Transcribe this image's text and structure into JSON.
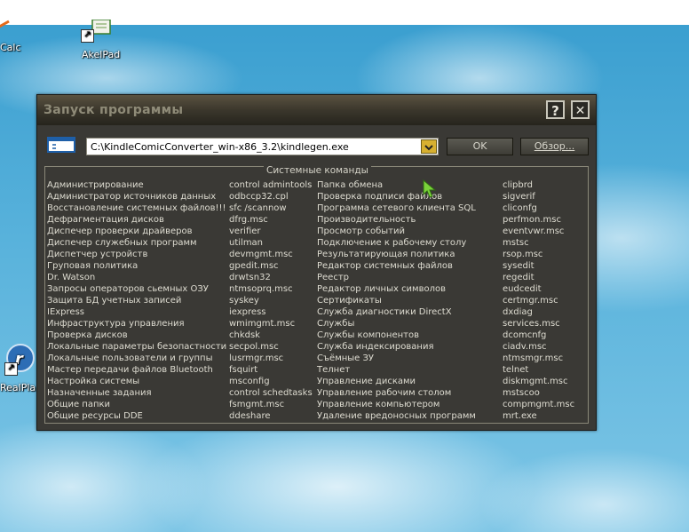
{
  "desktop": {
    "icons": [
      {
        "name": "Calc",
        "label": "Calc"
      },
      {
        "name": "AkelPad",
        "label": "AkelPad"
      },
      {
        "name": "RealPlayer",
        "label": "RealPla"
      }
    ]
  },
  "dialog": {
    "title": "Запуск программы",
    "help_label": "?",
    "close_label": "✕",
    "command_value": "C:\\KindleComicConverter_win-x86_3.2\\kindlegen.exe",
    "ok_label": "OK",
    "browse_label": "Обзор...",
    "group_title": "Системные команды",
    "columns": [
      {
        "items": [
          "Администрирование",
          "Администратор источников данных",
          "Восстановление системных файлов!!!",
          "Дефрагментация дисков",
          "Диспечер проверки драйверов",
          "Диспечер служебных программ",
          "Диспетчер устройств",
          "Груповая политика",
          "Dr. Watson",
          "Запросы операторов сьемных ОЗУ",
          "Защита БД учетных записей",
          "IExpress",
          "Инфраструктура управления",
          "Проверка дисков",
          "Локальные параметры безопастности",
          "Локальные пользователи и группы",
          "Мастер передачи файлов Bluetooth",
          "Настройка системы",
          "Назначенные задания",
          "Общие папки",
          "Общие ресурсы DDE"
        ]
      },
      {
        "items": [
          "control admintools",
          "odbccp32.cpl",
          "sfc /scannow",
          "dfrg.msc",
          "verifier",
          "utilman",
          "devmgmt.msc",
          "gpedit.msc",
          "drwtsn32",
          "ntmsoprq.msc",
          "syskey",
          "iexpress",
          "wmimgmt.msc",
          "chkdsk",
          "secpol.msc",
          "lusrmgr.msc",
          "fsquirt",
          "msconfig",
          "control schedtasks",
          "fsmgmt.msc",
          "ddeshare"
        ]
      },
      {
        "items": [
          "Папка обмена",
          "Проверка подписи файлов",
          "Программа сетевого клиента SQL",
          "Производительность",
          "Просмотр событий",
          "Подключение к рабочему столу",
          "Результатирующая политика",
          "Редактор системных файлов",
          "Реестр",
          "Редактор личных символов",
          "Сертификаты",
          "Служба диагностики DirectX",
          "Службы",
          "Службы компонентов",
          "Служба индексирования",
          "Съёмные ЗУ",
          "Телнет",
          "Управление дисками",
          "Управление рабочим столом",
          "Управление компьютером",
          "Удаление вредоносных программ"
        ]
      },
      {
        "items": [
          "clipbrd",
          "sigverif",
          "cliconfg",
          "perfmon.msc",
          "eventvwr.msc",
          "mstsc",
          "rsop.msc",
          "sysedit",
          "regedit",
          "eudcedit",
          "certmgr.msc",
          "dxdiag",
          "services.msc",
          "dcomcnfg",
          "ciadv.msc",
          "ntmsmgr.msc",
          "telnet",
          "diskmgmt.msc",
          "mstscoo",
          "compmgmt.msc",
          "mrt.exe"
        ]
      }
    ]
  }
}
